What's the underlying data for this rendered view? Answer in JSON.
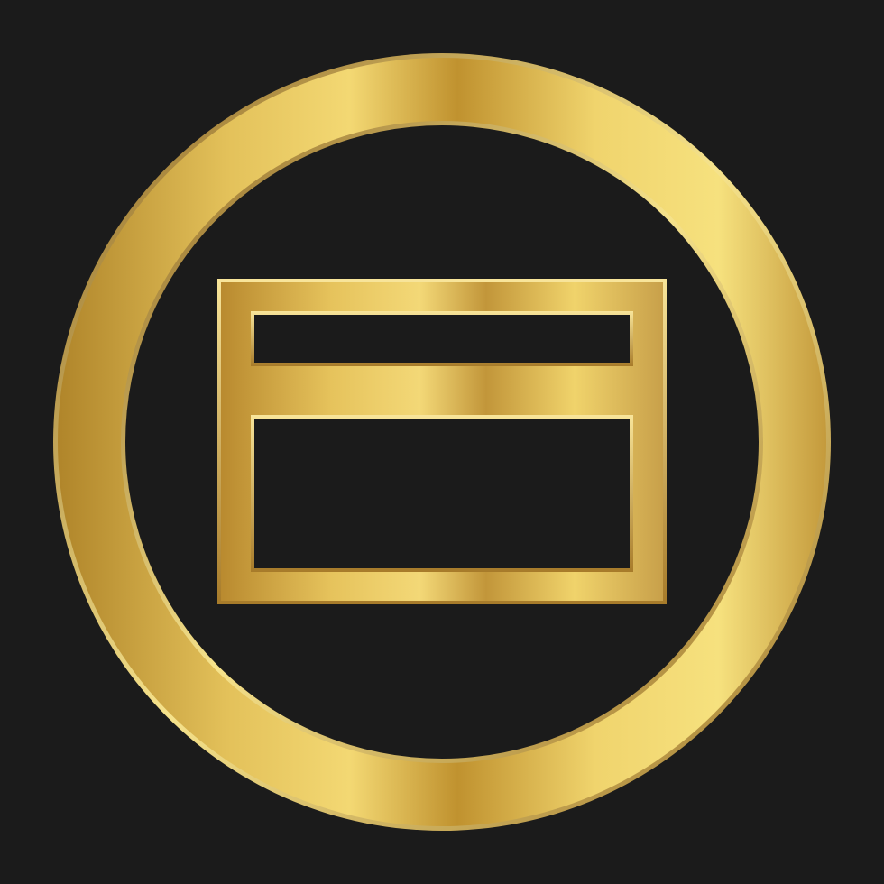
{
  "icon": {
    "name": "credit-card-icon",
    "badge": "gold-ring-badge"
  },
  "colors": {
    "background": "#1b1b1b",
    "gold_dark": "#b78a2f",
    "gold_mid": "#d6ad4a",
    "gold_light": "#f4dc79",
    "gold_edge": "#8c6420"
  }
}
